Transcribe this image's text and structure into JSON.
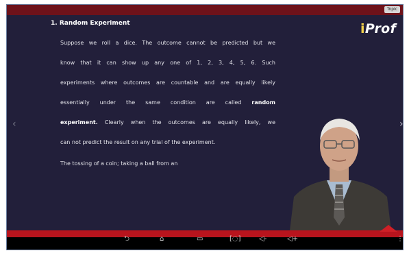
{
  "topbar": {
    "topic_label": "Topic"
  },
  "slide": {
    "heading": "1. Random Experiment",
    "lines": [
      "Suppose we roll a dice. The outcome cannot be predicted but we",
      "know that it can show up any one of 1, 2, 3, 4, 5, 6. Such",
      "experiments where outcomes are countable and are equally likely",
      "essentially under the same condition are called",
      "random",
      "experiment.",
      " Clearly when the outcomes are equally likely, we",
      "can not predict the result on any trial of the experiment.",
      "The tossing of a coin; taking a ball from an"
    ]
  },
  "logo": {
    "text_i": "i",
    "text_rest": "Prof"
  },
  "navigation": {
    "prev_arrow": "‹",
    "next_arrow": "›"
  },
  "android_nav": {
    "back": "⮌",
    "home": "⌂",
    "recents": "▭",
    "screenshot": "[◌]",
    "vol_down": "◁-",
    "vol_up": "◁+",
    "menu": "⋮"
  },
  "colors": {
    "topbar": "#6e121a",
    "slide_bg": "#221f3a",
    "bottombar": "#b8141d",
    "logo_dot": "#f2d04a"
  }
}
